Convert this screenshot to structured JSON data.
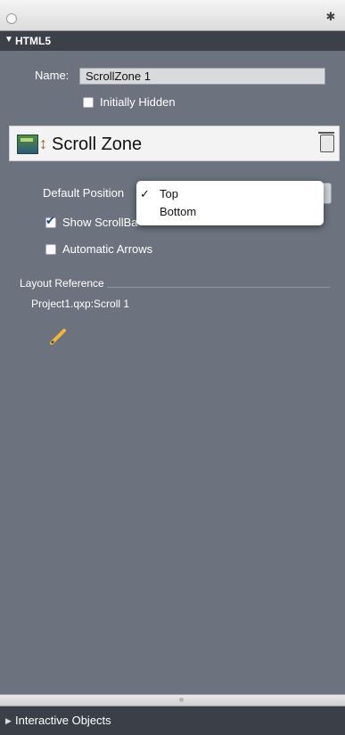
{
  "section": {
    "title": "HTML5",
    "expanded_glyph": "▼"
  },
  "name_field": {
    "label": "Name:",
    "value": "ScrollZone 1"
  },
  "initially_hidden": {
    "label": "Initially Hidden",
    "checked": false
  },
  "object": {
    "title": "Scroll Zone",
    "icon": "scroll-zone-icon",
    "delete_icon": "trash-icon"
  },
  "default_position": {
    "label": "Default Position",
    "options": [
      {
        "label": "Top",
        "selected": true,
        "mark": "✓"
      },
      {
        "label": "Bottom",
        "selected": false,
        "mark": ""
      }
    ]
  },
  "show_scrollbar": {
    "label": "Show ScrollBa",
    "checked": true
  },
  "automatic_arrows": {
    "label": "Automatic Arrows",
    "checked": false
  },
  "layout_reference": {
    "heading": "Layout Reference",
    "value": "Project1.qxp:Scroll 1",
    "edit_icon": "pencil-icon"
  },
  "footer": {
    "label": "Interactive Objects",
    "glyph": "▶"
  },
  "colors": {
    "panel_bg": "#6c737e",
    "header_bg": "#3c4049",
    "footer_bg": "#3a3f48",
    "text": "#ffffff"
  }
}
